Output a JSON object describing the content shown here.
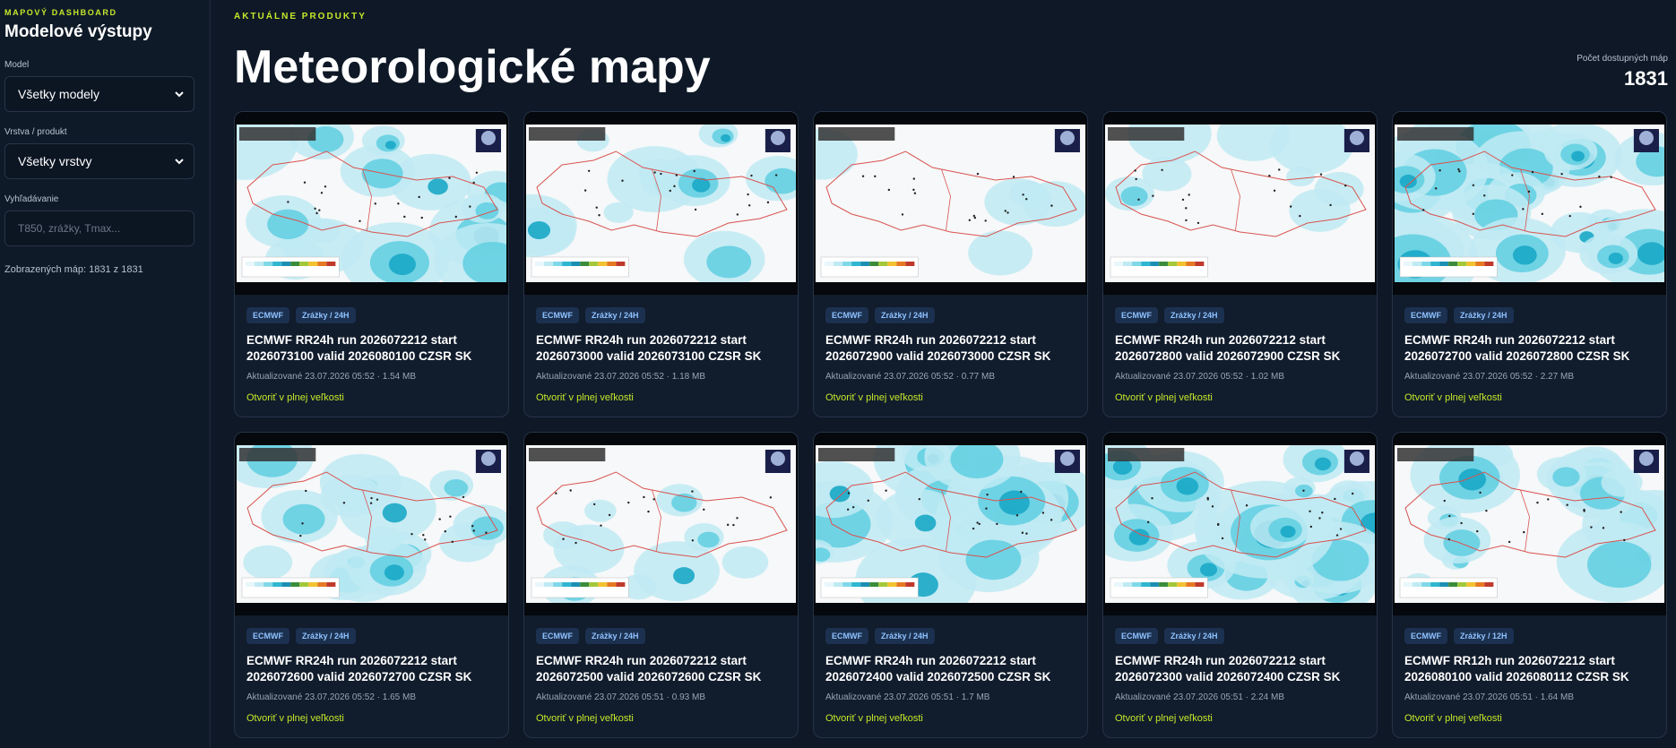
{
  "sidebar": {
    "eyebrow": "MAPOVÝ DASHBOARD",
    "title": "Modelové výstupy",
    "model_label": "Model",
    "model_value": "Všetky modely",
    "layer_label": "Vrstva / produkt",
    "layer_value": "Všetky vrstvy",
    "search_label": "Vyhľadávanie",
    "search_placeholder": "T850, zrážky, Tmax...",
    "search_value": "",
    "shown_count": "Zobrazených máp: 1831 z 1831"
  },
  "header": {
    "eyebrow": "AKTUÁLNE PRODUKTY",
    "title": "Meteorologické mapy",
    "stat_label": "Počet dostupných máp",
    "stat_value": "1831"
  },
  "link_label": "Otvoriť v plnej veľkosti",
  "colors": {
    "accent": "#c5e82a",
    "background": "#0e1826",
    "card": "#111c2c",
    "badge_bg": "#1c3150",
    "badge_text": "#8fc2ff",
    "precip_light": "#bfeaf3",
    "precip_mid": "#5fcfe0",
    "precip_heavy": "#19a9c6"
  },
  "cards": [
    {
      "model": "ECMWF",
      "layer": "Zrážky / 24H",
      "title": "ECMWF RR24h run 2026072212 start 2026073100 valid 2026080100 CZSR SK",
      "meta": "Aktualizované 23.07.2026 05:52 · 1.54 MB",
      "intensity": 0.55
    },
    {
      "model": "ECMWF",
      "layer": "Zrážky / 24H",
      "title": "ECMWF RR24h run 2026072212 start 2026073000 valid 2026073100 CZSR SK",
      "meta": "Aktualizované 23.07.2026 05:52 · 1.18 MB",
      "intensity": 0.4
    },
    {
      "model": "ECMWF",
      "layer": "Zrážky / 24H",
      "title": "ECMWF RR24h run 2026072212 start 2026072900 valid 2026073000 CZSR SK",
      "meta": "Aktualizované 23.07.2026 05:52 · 0.77 MB",
      "intensity": 0.08
    },
    {
      "model": "ECMWF",
      "layer": "Zrážky / 24H",
      "title": "ECMWF RR24h run 2026072212 start 2026072800 valid 2026072900 CZSR SK",
      "meta": "Aktualizované 23.07.2026 05:52 · 1.02 MB",
      "intensity": 0.22
    },
    {
      "model": "ECMWF",
      "layer": "Zrážky / 24H",
      "title": "ECMWF RR24h run 2026072212 start 2026072700 valid 2026072800 CZSR SK",
      "meta": "Aktualizované 23.07.2026 05:52 · 2.27 MB",
      "intensity": 0.95
    },
    {
      "model": "ECMWF",
      "layer": "Zrážky / 24H",
      "title": "ECMWF RR24h run 2026072212 start 2026072600 valid 2026072700 CZSR SK",
      "meta": "Aktualizované 23.07.2026 05:52 · 1.65 MB",
      "intensity": 0.6
    },
    {
      "model": "ECMWF",
      "layer": "Zrážky / 24H",
      "title": "ECMWF RR24h run 2026072212 start 2026072500 valid 2026072600 CZSR SK",
      "meta": "Aktualizované 23.07.2026 05:51 · 0.93 MB",
      "intensity": 0.3
    },
    {
      "model": "ECMWF",
      "layer": "Zrážky / 24H",
      "title": "ECMWF RR24h run 2026072212 start 2026072400 valid 2026072500 CZSR SK",
      "meta": "Aktualizované 23.07.2026 05:51 · 1.7 MB",
      "intensity": 0.75
    },
    {
      "model": "ECMWF",
      "layer": "Zrážky / 24H",
      "title": "ECMWF RR24h run 2026072212 start 2026072300 valid 2026072400 CZSR SK",
      "meta": "Aktualizované 23.07.2026 05:51 · 2.24 MB",
      "intensity": 1.0
    },
    {
      "model": "ECMWF",
      "layer": "Zrážky / 12H",
      "title": "ECMWF RR12h run 2026072212 start 2026080100 valid 2026080112 CZSR SK",
      "meta": "Aktualizované 23.07.2026 05:51 · 1.64 MB",
      "intensity": 0.7
    }
  ]
}
